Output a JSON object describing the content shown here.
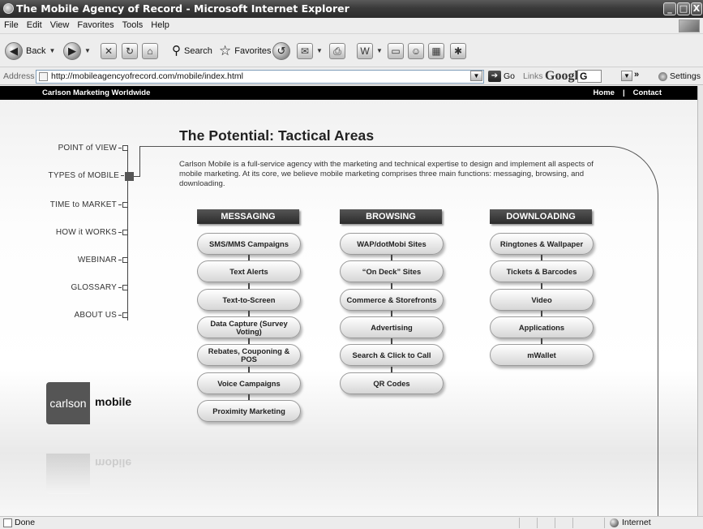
{
  "window": {
    "title": "The Mobile Agency of Record - Microsoft Internet Explorer",
    "controls": {
      "minimize": "_",
      "maximize": "□",
      "close": "X"
    }
  },
  "menu": [
    "File",
    "Edit",
    "View",
    "Favorites",
    "Tools",
    "Help"
  ],
  "toolbar": {
    "back_label": "Back",
    "search_label": "Search",
    "favorites_label": "Favorites"
  },
  "address": {
    "label": "Address",
    "url": "http://mobileagencyofrecord.com/mobile/index.html",
    "go_label": "Go",
    "links_label": "Links",
    "google_logo": "Google",
    "google_box": "G",
    "more": "»",
    "settings_label": "Settings"
  },
  "site": {
    "brand": "Carlson Marketing Worldwide",
    "nav": {
      "home": "Home",
      "separator": "|",
      "contact": "Contact"
    },
    "left_nav": [
      {
        "label": "POINT of VIEW",
        "active": false
      },
      {
        "label": "TYPES of MOBILE",
        "active": true
      },
      {
        "label": "TIME to MARKET",
        "active": false
      },
      {
        "label": "HOW it WORKS",
        "active": false
      },
      {
        "label": "WEBINAR",
        "active": false
      },
      {
        "label": "GLOSSARY",
        "active": false
      },
      {
        "label": "ABOUT US",
        "active": false
      }
    ],
    "headline": "The Potential: Tactical Areas",
    "intro": "Carlson Mobile is a full-service agency with the marketing and technical expertise to design and implement all aspects of mobile marketing. At its core, we believe mobile marketing comprises three main functions: messaging, browsing, and downloading.",
    "columns": [
      {
        "title": "MESSAGING",
        "items": [
          "SMS/MMS Campaigns",
          "Text Alerts",
          "Text-to-Screen",
          "Data Capture (Survey Voting)",
          "Rebates, Couponing & POS",
          "Voice Campaigns",
          "Proximity Marketing"
        ]
      },
      {
        "title": "BROWSING",
        "items": [
          "WAP/dotMobi Sites",
          "“On Deck” Sites",
          "Commerce & Storefronts",
          "Advertising",
          "Search & Click to Call",
          "QR Codes"
        ]
      },
      {
        "title": "DOWNLOADING",
        "items": [
          "Ringtones & Wallpaper",
          "Tickets & Barcodes",
          "Video",
          "Applications",
          "mWallet"
        ]
      }
    ],
    "logo": {
      "left": "carlson",
      "right": "mobile"
    }
  },
  "status": {
    "text": "Done",
    "zone": "Internet"
  }
}
